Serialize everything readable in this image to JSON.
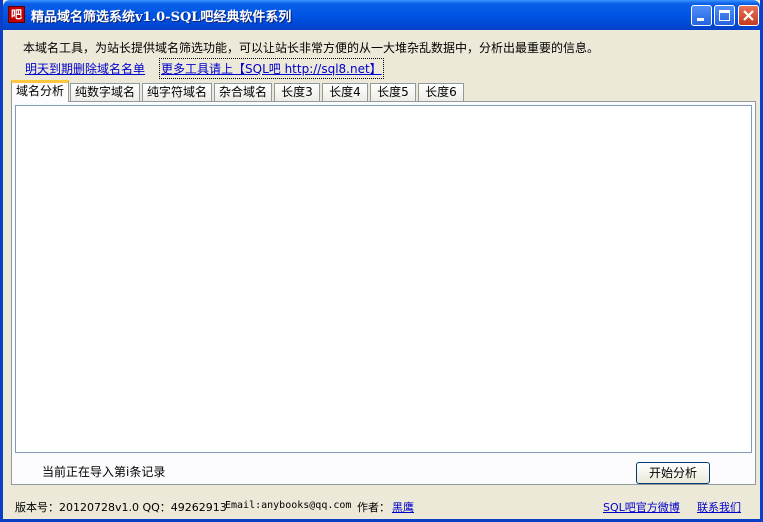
{
  "window": {
    "title": "精品域名筛选系统v1.0-SQL吧经典软件系列",
    "icon_glyph": "吧"
  },
  "header": {
    "description": "本域名工具，为站长提供域名筛选功能，可以让站长非常方便的从一大堆杂乱数据中，分析出最重要的信息。",
    "link_expired": "明天到期删除域名名单",
    "link_more_tools": "更多工具请上【SQL吧 http://sql8.net】"
  },
  "tabs": [
    {
      "label": "域名分析",
      "active": true
    },
    {
      "label": "纯数字域名"
    },
    {
      "label": "纯字符域名"
    },
    {
      "label": "杂合域名"
    },
    {
      "label": "长度3"
    },
    {
      "label": "长度4"
    },
    {
      "label": "长度5"
    },
    {
      "label": "长度6"
    }
  ],
  "main": {
    "status_text": "当前正在导入第i条记录",
    "start_button": "开始分析"
  },
  "footer": {
    "version": "版本号：20120728v1.0 QQ：49262913",
    "email": "Email:anybooks@qq.com",
    "author_label": "作者：",
    "author_name": "黑鹰",
    "weibo_link": "SQL吧官方微博",
    "contact_link": "联系我们"
  },
  "colors": {
    "titlebar": "#0055e5",
    "link": "#0000cc",
    "active_tab_accent": "#ffc83c"
  }
}
